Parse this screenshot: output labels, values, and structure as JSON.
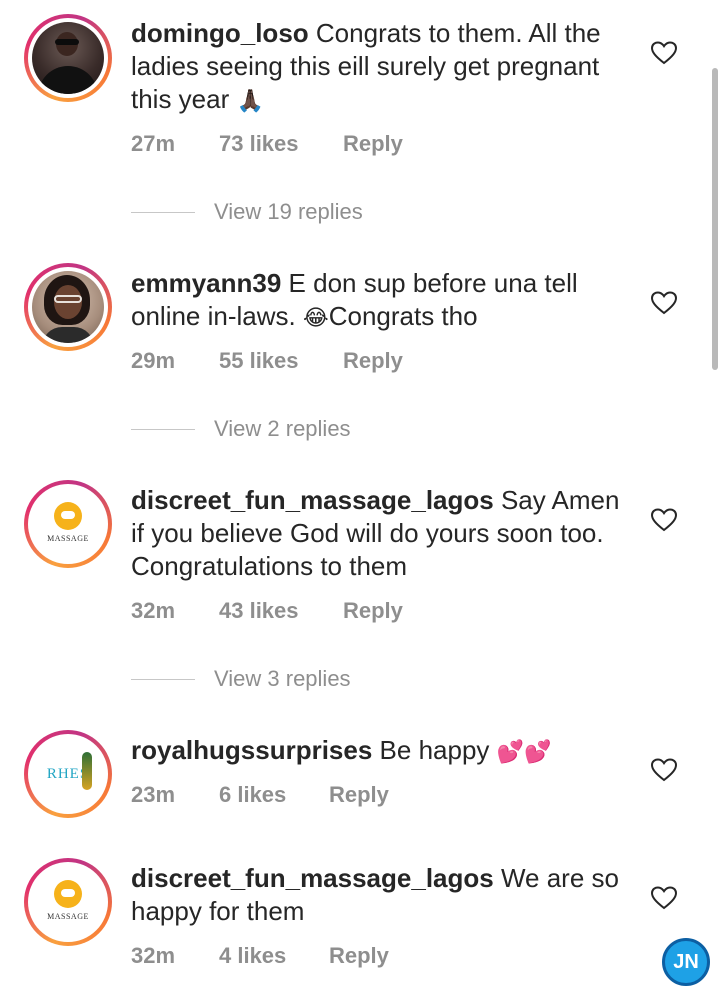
{
  "comments": [
    {
      "username": "domingo_loso",
      "text": "Congrats to them. All the ladies seeing this eill surely get pregnant this year",
      "emoji": "🙏🏿",
      "time": "27m",
      "likes": "73 likes",
      "reply": "Reply",
      "view_replies": "View 19 replies"
    },
    {
      "username": "emmyann39",
      "text": "E don sup before una tell online in-laws.",
      "emoji": "😂",
      "text_after": "Congrats tho",
      "time": "29m",
      "likes": "55 likes",
      "reply": "Reply",
      "view_replies": "View 2 replies"
    },
    {
      "username": "discreet_fun_massage_lagos",
      "text": "Say Amen if you believe God will do yours soon too. Congratulations to them",
      "time": "32m",
      "likes": "43 likes",
      "reply": "Reply",
      "view_replies": "View 3 replies",
      "avatar_caption": "MASSAGE"
    },
    {
      "username": "royalhugssurprises",
      "text": "Be happy",
      "emoji": "💕💕",
      "time": "23m",
      "likes": "6 likes",
      "reply": "Reply",
      "avatar_caption": "RHES"
    },
    {
      "username": "discreet_fun_massage_lagos",
      "text": "We are so happy for them",
      "time": "32m",
      "likes": "4 likes",
      "reply": "Reply",
      "avatar_caption": "MASSAGE"
    }
  ],
  "watermark": "JN",
  "colors": {
    "text": "#262626",
    "meta": "#8e8e8e",
    "ring_start": "#f9a03f",
    "ring_end": "#c13584"
  }
}
